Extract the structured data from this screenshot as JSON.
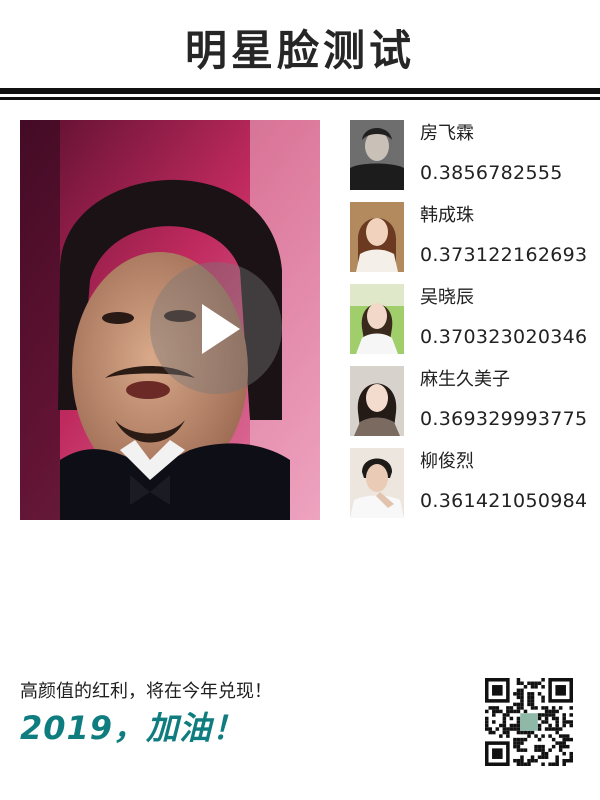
{
  "header": {
    "title": "明星脸测试"
  },
  "main_photo": {
    "icon": "play-icon"
  },
  "matches": [
    {
      "name": "房飞霖",
      "score": "0.3856782555"
    },
    {
      "name": "韩成珠",
      "score": "0.373122162693"
    },
    {
      "name": "吴晓辰",
      "score": "0.370323020346"
    },
    {
      "name": "麻生久美子",
      "score": "0.369329993775"
    },
    {
      "name": "柳俊烈",
      "score": "0.361421050984"
    }
  ],
  "footer": {
    "slogan": "高颜值的红利，将在今年兑现！",
    "cheer": "2019，加油！",
    "qr_icon": "qr-code-icon"
  },
  "colors": {
    "title": "#262626",
    "rule": "#111111",
    "cheer": "#0f7d7f",
    "photo_bg": "#d63a6e"
  }
}
